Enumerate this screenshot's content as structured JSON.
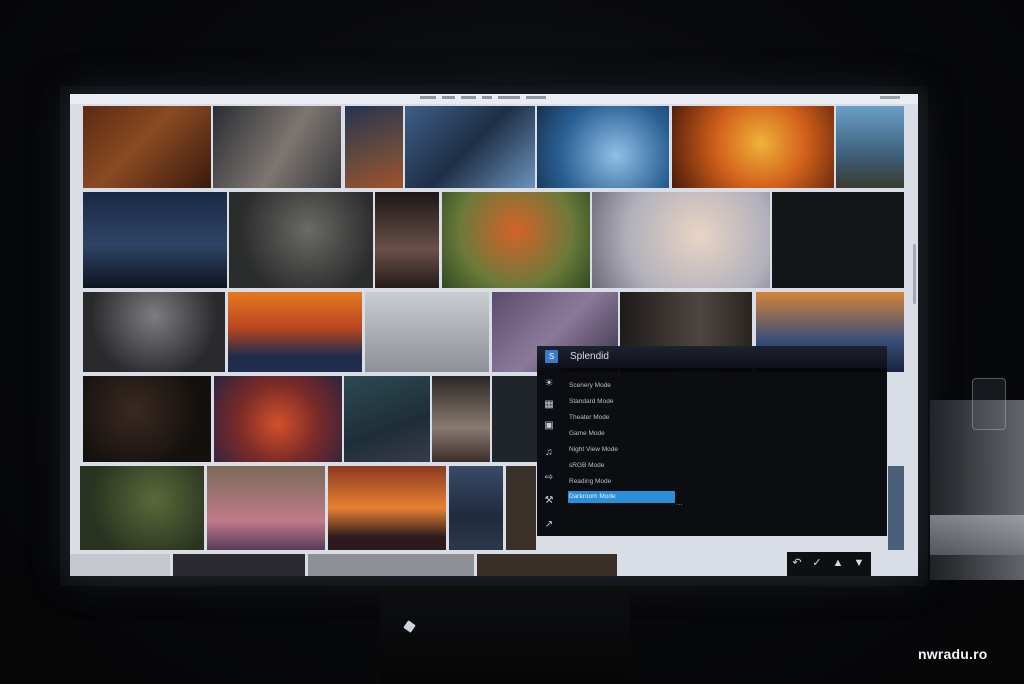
{
  "osd": {
    "title": "Splendid",
    "items": [
      "Scenery Mode",
      "Standard Mode",
      "Theater Mode",
      "Game Mode",
      "Night View Mode",
      "sRGB Mode",
      "Reading Mode",
      "Darkroom Mode"
    ],
    "selected_index": 7,
    "ellipsis": "...",
    "controls": [
      "back-icon",
      "check-icon",
      "up-icon",
      "down-icon"
    ],
    "accent_color": "#2b8fd8"
  },
  "side_icons": [
    "splendid-icon",
    "bluelight-icon",
    "color-icon",
    "image-icon",
    "sound-icon",
    "input-icon",
    "settings-icon",
    "shortcut-icon"
  ],
  "watermark": "nwradu.ro"
}
